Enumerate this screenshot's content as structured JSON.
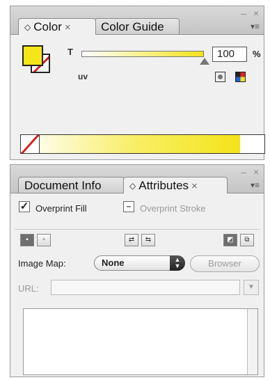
{
  "color_panel": {
    "tabs": [
      {
        "label": "Color",
        "close": "×"
      },
      {
        "label": "Color Guide"
      }
    ],
    "window_controls": "– ×",
    "menu_icon": "▾≡",
    "tint_label": "T",
    "tint_value": "100",
    "tint_unit": "%",
    "ink_label": "uv",
    "fill_color": "#f5e61a"
  },
  "attributes_panel": {
    "tabs": [
      {
        "label": "Document Info"
      },
      {
        "label": "Attributes",
        "close": "×"
      }
    ],
    "window_controls": "– ×",
    "menu_icon": "▾≡",
    "overprint_fill": {
      "label": "Overprint Fill",
      "checked": true
    },
    "overprint_stroke": {
      "label": "Overprint Stroke",
      "state": "mixed"
    },
    "image_map_label": "Image Map:",
    "image_map_value": "None",
    "browser_button": "Browser",
    "url_label": "URL:"
  }
}
